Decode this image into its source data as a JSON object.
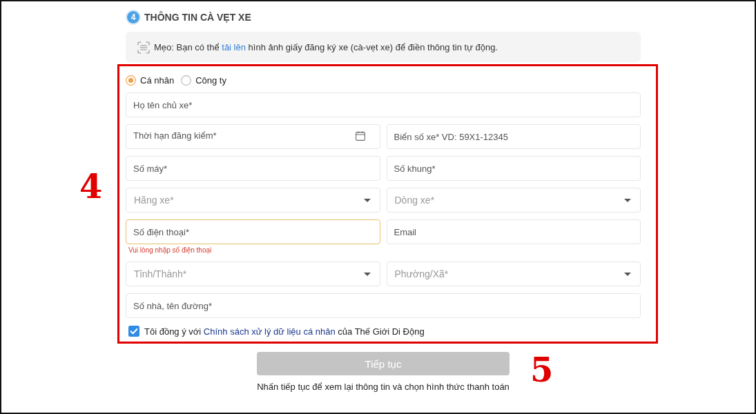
{
  "section": {
    "step": "4",
    "title": "THÔNG TIN CÀ VẸT XE"
  },
  "tip": {
    "before": "Mẹo: Bạn có thể",
    "link": "tải lên",
    "after": "hình ảnh giấy đăng ký xe (cà-vẹt xe) để điền thông tin tự động."
  },
  "owner_type": [
    {
      "label": "Cá nhân",
      "selected": true
    },
    {
      "label": "Công ty",
      "selected": false
    }
  ],
  "form": {
    "rows": [
      {
        "fields": [
          {
            "kind": "text",
            "placeholder": "Họ tên chủ xe*",
            "invalid": false
          }
        ]
      },
      {
        "fields": [
          {
            "kind": "date",
            "placeholder": "Thời hạn đăng kiểm*",
            "invalid": false
          },
          {
            "kind": "text",
            "placeholder": "Biển số xe* VD: 59X1-12345",
            "invalid": false
          }
        ]
      },
      {
        "fields": [
          {
            "kind": "text",
            "placeholder": "Số máy*",
            "invalid": false
          },
          {
            "kind": "text",
            "placeholder": "Số khung*",
            "invalid": false
          }
        ]
      },
      {
        "fields": [
          {
            "kind": "select",
            "placeholder": "Hãng xe*",
            "invalid": false
          },
          {
            "kind": "select",
            "placeholder": "Dòng xe*",
            "invalid": false
          }
        ]
      },
      {
        "fields": [
          {
            "kind": "text",
            "placeholder": "Số điện thoại*",
            "invalid": true,
            "error": "Vui lòng nhập số điện thoại"
          },
          {
            "kind": "text",
            "placeholder": "Email",
            "invalid": false
          }
        ]
      },
      {
        "fields": [
          {
            "kind": "select",
            "placeholder": "Tỉnh/Thành*",
            "invalid": false
          },
          {
            "kind": "select",
            "placeholder": "Phường/Xã*",
            "invalid": false
          }
        ]
      },
      {
        "fields": [
          {
            "kind": "text",
            "placeholder": "Số nhà, tên đường*",
            "invalid": false
          }
        ]
      }
    ]
  },
  "consent": {
    "checked": true,
    "before": "Tôi đồng ý với",
    "link": "Chính sách xử lý dữ liệu cá nhân",
    "after": "của Thế Giới Di Động"
  },
  "submit": {
    "label": "Tiếp tục",
    "disabled": true
  },
  "note": "Nhấn tiếp tục để xem lại thông tin và chọn hình thức thanh toán",
  "callouts": {
    "form": "4",
    "button": "5"
  }
}
